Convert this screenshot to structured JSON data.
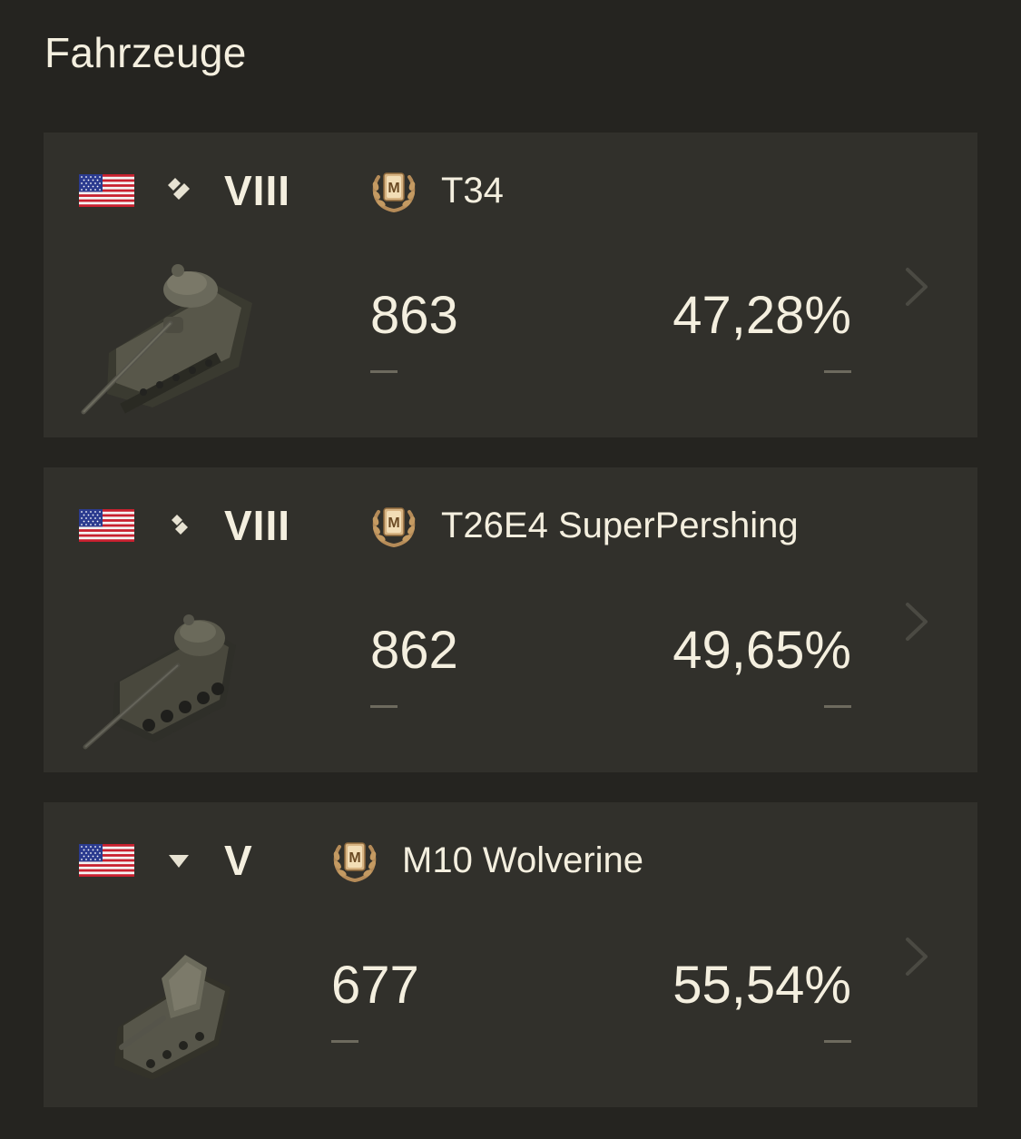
{
  "section_title": "Fahrzeuge",
  "vehicles": [
    {
      "nation": "USA",
      "class": "heavy-tank",
      "tier": "VIII",
      "mastery_badge": "M",
      "name": "T34",
      "battles": "863",
      "battles_change": "—",
      "win_rate": "47,28%",
      "win_rate_change": "—"
    },
    {
      "nation": "USA",
      "class": "medium-tank",
      "tier": "VIII",
      "mastery_badge": "M",
      "name": "T26E4 SuperPershing",
      "battles": "862",
      "battles_change": "—",
      "win_rate": "49,65%",
      "win_rate_change": "—"
    },
    {
      "nation": "USA",
      "class": "tank-destroyer",
      "tier": "V",
      "mastery_badge": "M",
      "name": "M10 Wolverine",
      "battles": "677",
      "battles_change": "—",
      "win_rate": "55,54%",
      "win_rate_change": "—"
    }
  ],
  "colors": {
    "background": "#252420",
    "card": "#31302b",
    "text": "#f4efdf",
    "muted": "#6d6a5e",
    "badge_gold": "#c49a62"
  }
}
